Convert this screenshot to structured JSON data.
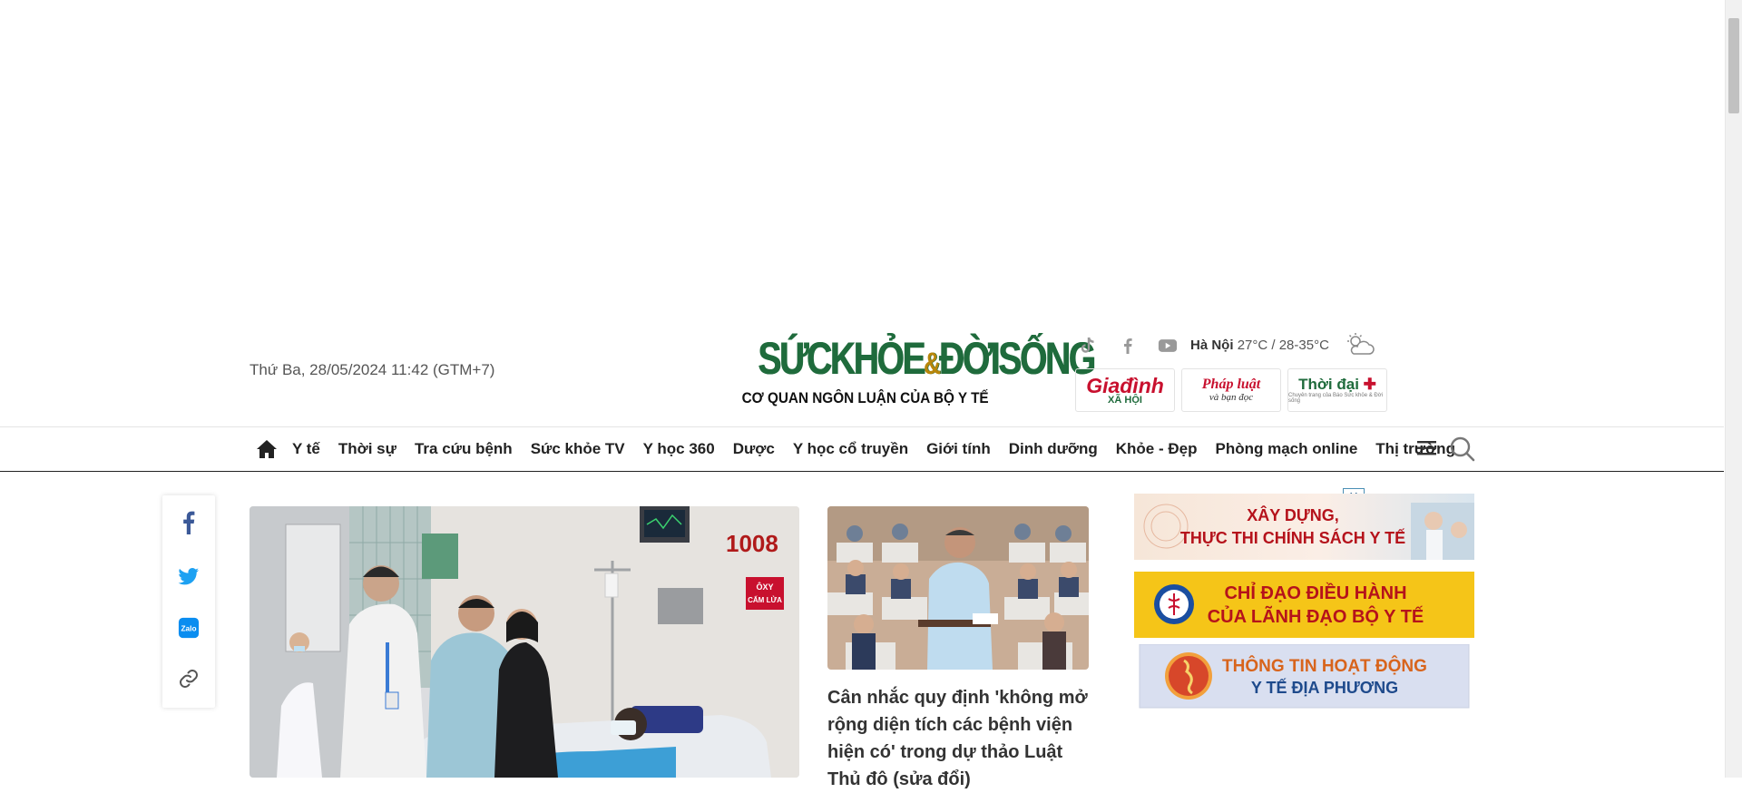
{
  "header": {
    "date": "Thứ Ba, 28/05/2024 11:42 (GTM+7)",
    "logo_main_left": "SỨCKHỎE",
    "logo_amp": "&",
    "logo_main_right": "ĐỜISỐNG",
    "logo_tagline": "CƠ QUAN NGÔN LUẬN CỦA BỘ Y TẾ",
    "social": [
      "tiktok-icon",
      "facebook-icon",
      "youtube-icon"
    ],
    "weather_city": "Hà Nội",
    "weather_temp": "27°C / 28-35°C",
    "partners": [
      {
        "line1": "Giađình",
        "line2": "XÃ HỘI"
      },
      {
        "line1": "Pháp luật",
        "line2": "và bạn đọc"
      },
      {
        "line1": "Thời đại",
        "line2": "Chuyên trang của Báo Sức khỏe & Đời sống"
      }
    ]
  },
  "nav": {
    "items": [
      "Y tế",
      "Thời sự",
      "Tra cứu bệnh",
      "Sức khỏe TV",
      "Y học 360",
      "Dược",
      "Y học cổ truyền",
      "Giới tính",
      "Dinh dưỡng",
      "Khỏe - Đẹp",
      "Phòng mạch online",
      "Thị trường"
    ]
  },
  "hero": {
    "room_sign": "1008",
    "oxy_sign_1": "ÔXY",
    "oxy_sign_2": "CẤM LỬA"
  },
  "side_article": {
    "title": "Cân nhắc quy định 'không mở rộng diện tích các bệnh viện hiện có' trong dự thảo Luật Thủ đô (sửa đổi)"
  },
  "ads": {
    "close_label": "X",
    "ad1_line1": "XÂY DỰNG,",
    "ad1_line2": "THỰC THI CHÍNH SÁCH Y TẾ",
    "ad2_line1": "CHỈ ĐẠO ĐIỀU HÀNH",
    "ad2_line2": "CỦA LÃNH ĐẠO BỘ Y TẾ",
    "ad3_line1": "THÔNG TIN HOẠT ĐỘNG",
    "ad3_line2": "Y TẾ ĐỊA PHƯƠNG"
  },
  "colors": {
    "brand_green": "#1f6b3c",
    "brand_red": "#c8102e",
    "ad_yellow": "#f5c518"
  }
}
